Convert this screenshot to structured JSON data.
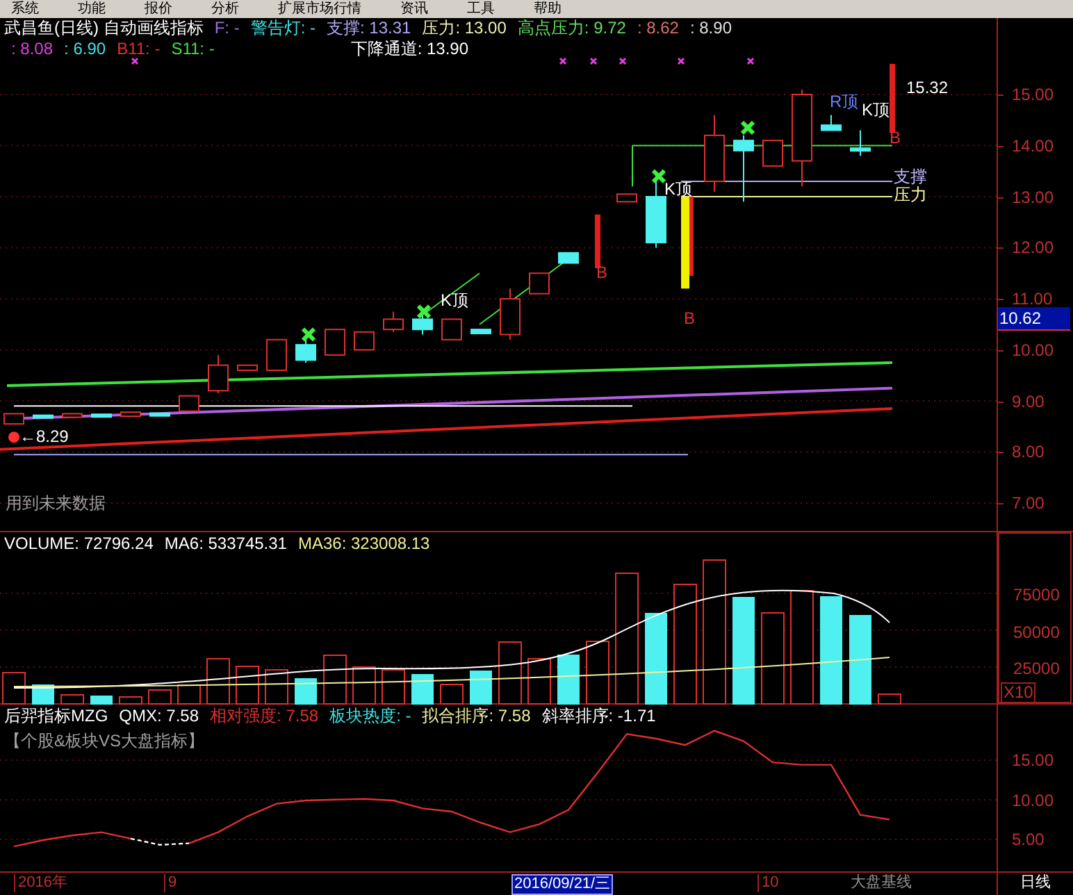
{
  "menu": [
    "系统",
    "功能",
    "报价",
    "分析",
    "扩展市场行情",
    "资讯",
    "工具",
    "帮助"
  ],
  "price_panel": {
    "title": "武昌鱼(日线) 自动画线指标",
    "line_1": [
      {
        "text": "F: -",
        "color": "#a070e0"
      },
      {
        "text": "警告灯: -",
        "color": "#40e0e0"
      },
      {
        "text": "支撑: 13.31",
        "color": "#b0a8f0"
      },
      {
        "text": "压力: 13.00",
        "color": "#f0f0b0"
      },
      {
        "text": "高点压力: 9.72",
        "color": "#60e060"
      },
      {
        "text": ": 8.62",
        "color": "#e07070"
      },
      {
        "text": ": 8.90",
        "color": "#e0e0e0"
      }
    ],
    "line_2": [
      {
        "text": ": 8.08",
        "color": "#e040e0"
      },
      {
        "text": ": 6.90",
        "color": "#40e0e0"
      },
      {
        "text": "B11: -",
        "color": "#e03030"
      },
      {
        "text": "S11: -",
        "color": "#40e040"
      },
      {
        "text": "下降通道: 13.90",
        "color": "#ffffff"
      }
    ],
    "labels": [
      {
        "text": "R顶",
        "color": "#6a80ff"
      },
      {
        "text": "K顶",
        "color": "#ffffff"
      },
      {
        "text": "K顶",
        "color": "#ffffff"
      },
      {
        "text": "K顶",
        "color": "#ffffff"
      },
      {
        "text": "支撑",
        "color": "#c0b8ff"
      },
      {
        "text": "压力",
        "color": "#ffffa0"
      },
      {
        "text": "B",
        "color": "#e03030"
      },
      {
        "text": "B",
        "color": "#e03030"
      },
      {
        "text": "B",
        "color": "#e03030"
      },
      {
        "text": "15.32",
        "color": "#ffffff"
      },
      {
        "text": "←8.29",
        "color": "#ffffff"
      },
      {
        "text": "用到未来数据",
        "color": "#a0a0a0"
      }
    ],
    "axis_ticks": [
      "15.00",
      "14.00",
      "13.00",
      "12.00",
      "11.00",
      "10.00",
      "9.00",
      "8.00",
      "7.00"
    ],
    "current_price": "10.62"
  },
  "volume_panel": {
    "header": [
      {
        "text": "VOLUME: 72796.24",
        "color": "#ffffff"
      },
      {
        "text": "MA6: 533745.31",
        "color": "#ffffff"
      },
      {
        "text": "MA36: 323008.13",
        "color": "#f0f090"
      }
    ],
    "unit": "X10",
    "axis_ticks": [
      "75000",
      "50000",
      "25000"
    ]
  },
  "indicator_panel": {
    "header": [
      {
        "text": "后羿指标MZG",
        "color": "#ffffff"
      },
      {
        "text": "QMX: 7.58",
        "color": "#ffffff"
      },
      {
        "text": "相对强度: 7.58",
        "color": "#e03030"
      },
      {
        "text": "板块热度: -",
        "color": "#40e0e0"
      },
      {
        "text": "拟合排序: 7.58",
        "color": "#f0f0a0"
      },
      {
        "text": "斜率排序: -1.71",
        "color": "#ffffff"
      }
    ],
    "subtitle": "【个股&板块VS大盘指标】",
    "axis_ticks": [
      "15.00",
      "10.00",
      "5.00"
    ]
  },
  "time_axis": [
    {
      "text": "2016年",
      "selected": false
    },
    {
      "text": "9",
      "selected": false
    },
    {
      "text": "2016/09/21/三",
      "selected": true
    },
    {
      "text": "10",
      "selected": false
    }
  ],
  "baseline_label": "大盘基线",
  "period": "日线"
}
